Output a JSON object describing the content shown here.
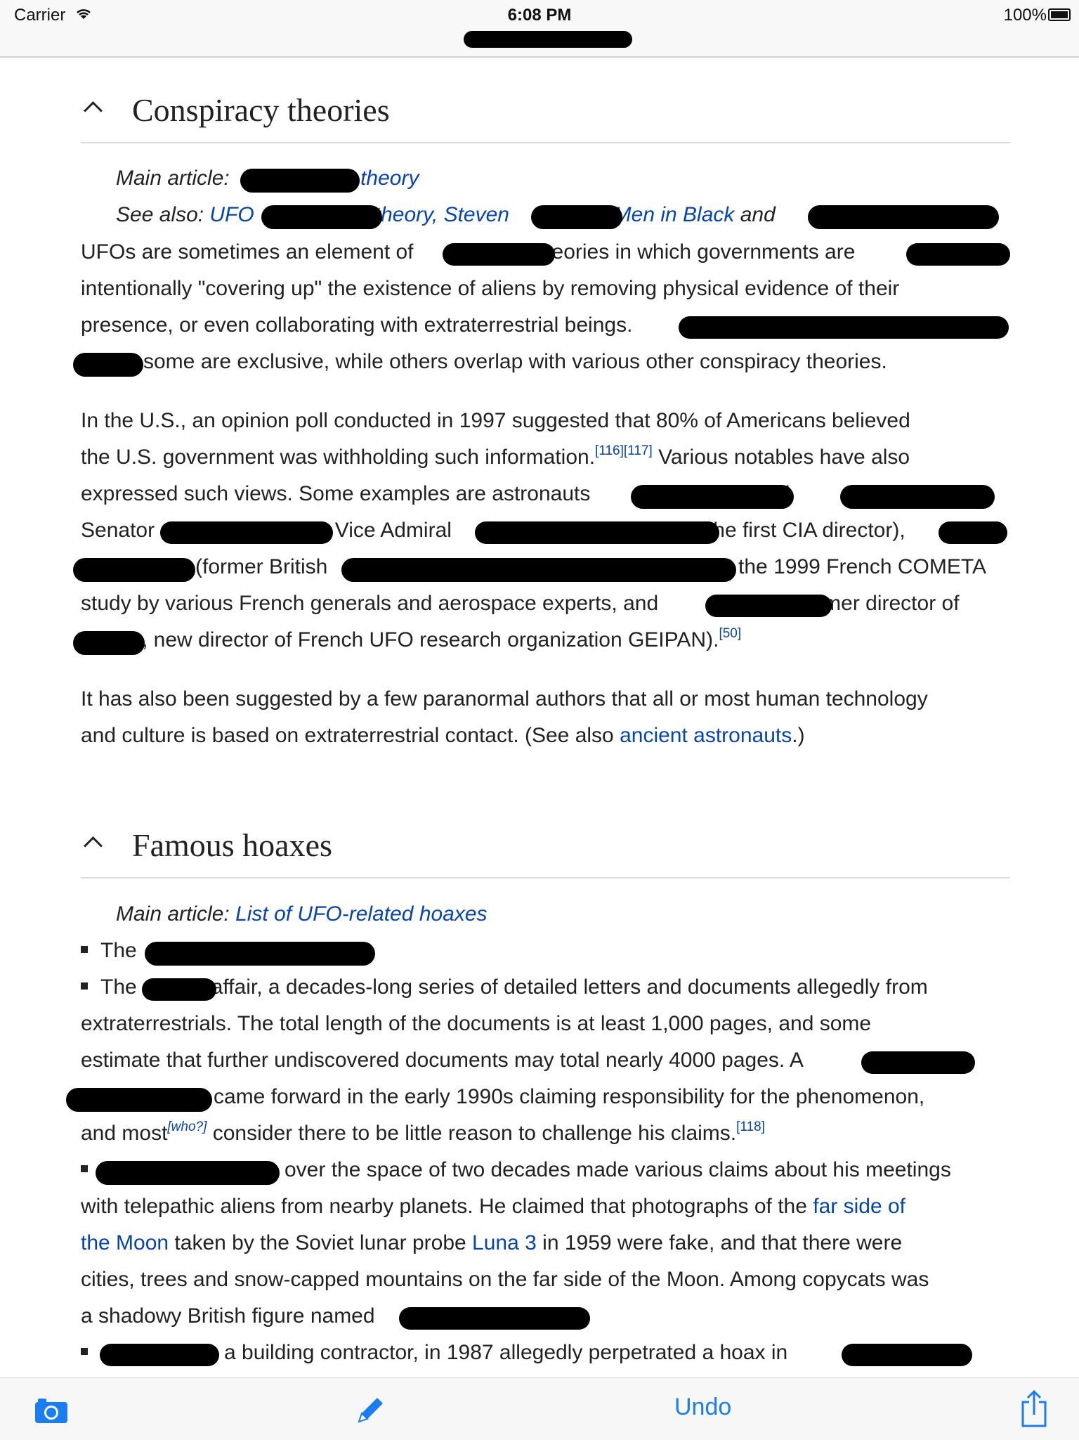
{
  "status_bar": {
    "carrier": "Carrier",
    "time": "6:08 PM",
    "battery": "100%"
  },
  "sections": [
    {
      "title": "Conspiracy theories",
      "hatnote_main_prefix": "Main article: ",
      "hatnote_main_link": "theory",
      "see_also_prefix": "See also: ",
      "see_also_ufo": "UFO",
      "see_also_theory": "theory, Steven",
      "see_also_comma": ", ",
      "see_also_mib": "Men in Black",
      "see_also_and": " and",
      "p1": [
        "UFOs are sometimes an element of",
        "theories in which governments are",
        "intentionally \"covering up\" the existence of aliens by removing physical evidence of their",
        "presence, or even collaborating with extraterrestrial beings.",
        "some are exclusive, while others overlap with various other conspiracy theories."
      ],
      "p2": {
        "l1": "In the U.S., an opinion poll conducted in 1997 suggested that 80% of Americans believed",
        "l2": "the U.S. government was withholding such information.",
        "ref116": "[116]",
        "ref117": "[117]",
        "l2b": " Various notables have also",
        "l3": "expressed such views. Some examples are astronauts",
        "l3b": "and",
        "l4a": "Senator",
        "l4b": ", Vice Admiral",
        "l4c": "(the first CIA director),",
        "l5a": "(former British",
        "l5b": ", the 1999 French COMETA",
        "l6a": "study by various French generals and aerospace experts, and",
        "l6b": "(former director of",
        "l7": ", new director of French UFO research organization GEIPAN).",
        "ref50": "[50]"
      },
      "p3": {
        "l1": "It has also been suggested by a few paranormal authors that all or most human technology",
        "l2": "and culture is based on extraterrestrial contact. (See also ",
        "link": "ancient astronauts",
        "end": ".)"
      }
    },
    {
      "title": "Famous hoaxes",
      "hatnote_main_prefix": "Main article: ",
      "hatnote_main_link": "List of UFO-related hoaxes",
      "items": {
        "i1": "The",
        "i2a": "The",
        "i2b": "affair, a decades-long series of detailed letters and documents allegedly from",
        "i2c": "extraterrestrials. The total length of the documents is at least 1,000 pages, and some",
        "i2d": "estimate that further undiscovered documents may total nearly 4000 pages. A",
        "i2e": "came forward in the early 1990s claiming responsibility for the phenomenon,",
        "i2f": "and most",
        "who": "[who?]",
        "i2g": " consider there to be little reason to challenge his claims.",
        "ref118": "[118]",
        "i3a": "over the space of two decades made various claims about his meetings",
        "i3b": "with telepathic aliens from nearby planets. He claimed that photographs of the ",
        "i3link1": "far side of",
        "i3link1b": "the Moon",
        "i3c": " taken by the Soviet lunar probe ",
        "i3link2": "Luna 3",
        "i3d": " in 1959 were fake, and that there were",
        "i3e": "cities, trees and snow-capped mountains on the far side of the Moon. Among copycats was",
        "i3f": "a shadowy British figure named",
        "i4": "a building contractor, in 1987 allegedly perpetrated a hoax in"
      }
    }
  ],
  "toolbar": {
    "camera_icon": "camera-icon",
    "pencil_icon": "pencil-icon",
    "undo": "Undo",
    "share_icon": "share-icon",
    "accent": "#1a7ef2"
  }
}
